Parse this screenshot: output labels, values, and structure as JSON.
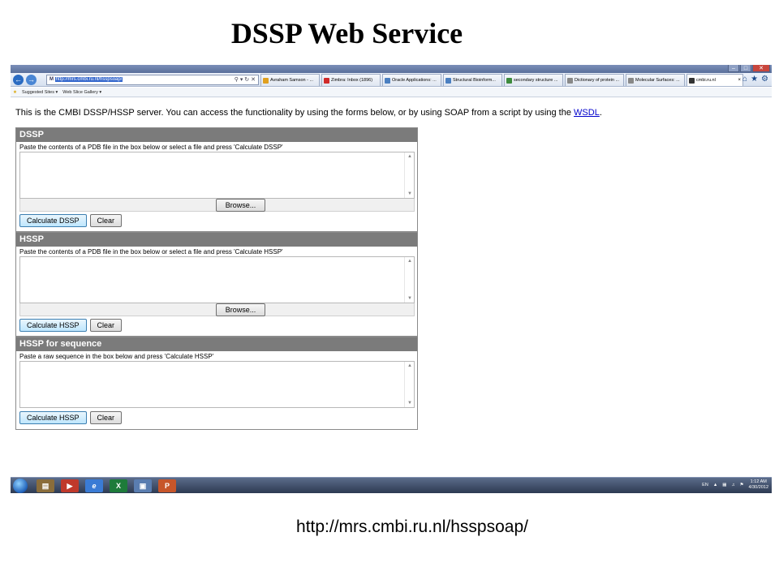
{
  "slide": {
    "title": "DSSP Web Service",
    "footer_url": "http://mrs.cmbi.ru.nl/hsspsoap/"
  },
  "browser": {
    "address": "http://mrs.cmbi.ru.nl/hsspsoap/",
    "tabs": [
      {
        "label": "Avraham Samson - ...",
        "color": "#e0a020"
      },
      {
        "label": "Zimbra: Inbox (1896)",
        "color": "#d02a2a"
      },
      {
        "label": "Oracle Applications: ...",
        "color": "#4a7fc1"
      },
      {
        "label": "Structural Bioinform...",
        "color": "#4a7fc1"
      },
      {
        "label": "secondary structure ...",
        "color": "#3d8b3d"
      },
      {
        "label": "Dictionary of protein ...",
        "color": "#888888"
      },
      {
        "label": "Molecular Surfaces: ...",
        "color": "#888888"
      },
      {
        "label": "cmbi.ru.nl",
        "color": "#333333"
      }
    ],
    "favorites": [
      "Suggested Sites ▾",
      "Web Slice Gallery ▾"
    ]
  },
  "page": {
    "intro_text": "This is the CMBI DSSP/HSSP server. You can access the functionality by using the forms below, or by using SOAP from a script by using the ",
    "intro_link": "WSDL",
    "intro_end": ".",
    "browse_label": "Browse...",
    "clear_label": "Clear",
    "panels": {
      "dssp": {
        "title": "DSSP",
        "desc": "Paste the contents of a PDB file in the box below or select a file and press 'Calculate DSSP'",
        "calc_label": "Calculate DSSP"
      },
      "hssp": {
        "title": "HSSP",
        "desc": "Paste the contents of a PDB file in the box below or select a file and press 'Calculate HSSP'",
        "calc_label": "Calculate HSSP"
      },
      "hssp_seq": {
        "title": "HSSP for sequence",
        "desc": "Paste a raw sequence in the box below and press 'Calculate HSSP'",
        "calc_label": "Calculate HSSP"
      }
    }
  },
  "taskbar": {
    "lang": "EN",
    "time": "1:12 AM",
    "date": "4/30/2012"
  }
}
